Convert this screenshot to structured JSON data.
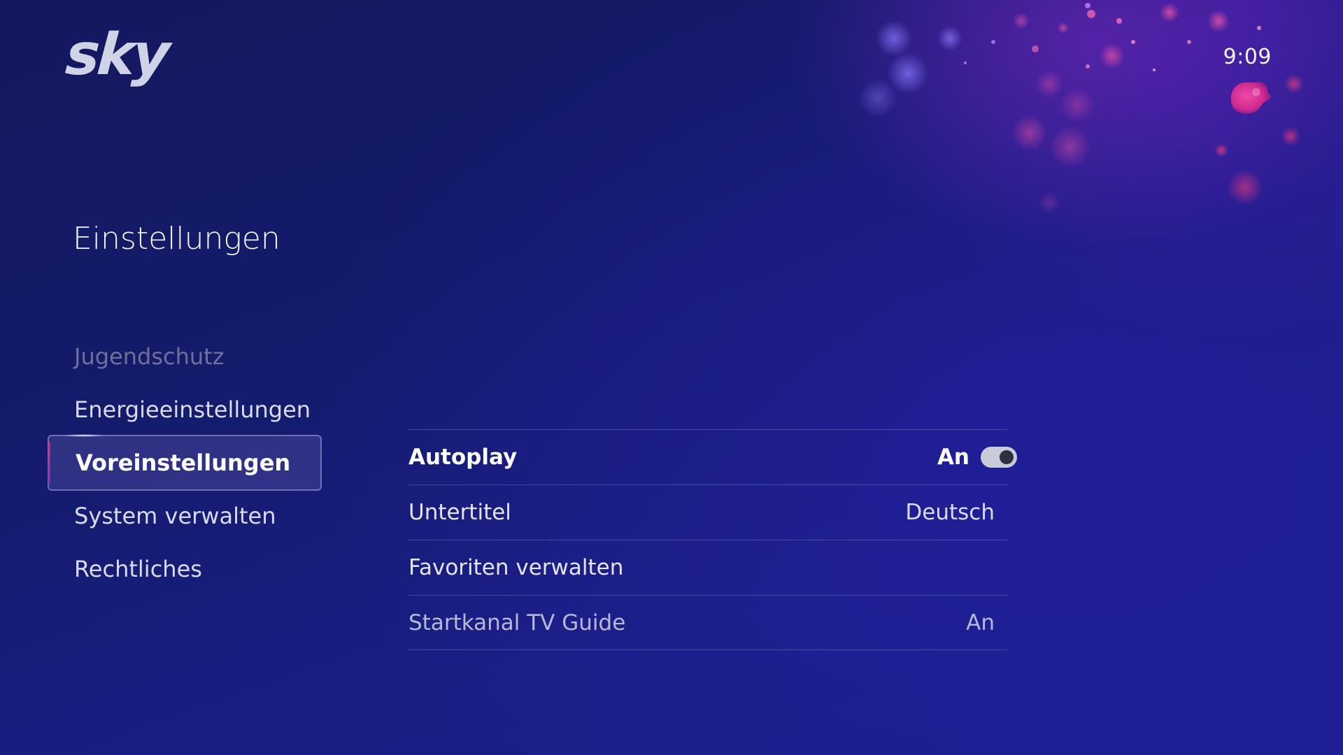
{
  "header": {
    "logo_text": "sky",
    "clock": "9:09",
    "avatar_icon": "profile-avatar-icon"
  },
  "page": {
    "title": "Einstellungen"
  },
  "nav": {
    "items": [
      {
        "label": "Jugendschutz",
        "state": "dim"
      },
      {
        "label": "Energieeinstellungen",
        "state": "normal"
      },
      {
        "label": "Voreinstellungen",
        "state": "selected"
      },
      {
        "label": "System verwalten",
        "state": "normal"
      },
      {
        "label": "Rechtliches",
        "state": "normal"
      }
    ]
  },
  "settings": {
    "rows": [
      {
        "label": "Autoplay",
        "value": "An",
        "control": "toggle",
        "toggle_on": true,
        "focused": true
      },
      {
        "label": "Untertitel",
        "value": "Deutsch"
      },
      {
        "label": "Favoriten verwalten",
        "value": ""
      },
      {
        "label": "Startkanal TV Guide",
        "value": "An",
        "muted": true
      }
    ]
  },
  "colors": {
    "background": "#151a6a",
    "accent_pink": "#e0397a",
    "text_primary": "#ffffff",
    "text_dim": "#6e7299"
  }
}
